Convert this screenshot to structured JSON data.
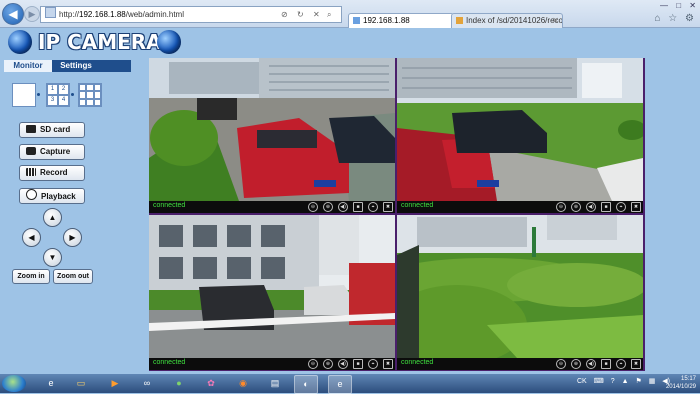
{
  "browser": {
    "address_url_prefix": "http://",
    "address_host": "192.168.1.88",
    "address_path": "/web/admin.html",
    "tabs": [
      {
        "label": "192.168.1.88"
      },
      {
        "label": "Index of /sd/20141026/record0..."
      }
    ],
    "window_controls": [
      "—",
      "□",
      "✕"
    ],
    "tool_icons": [
      "home-icon",
      "star-icon",
      "gear-icon"
    ]
  },
  "banner": {
    "title": "IP CAMERA"
  },
  "panel": {
    "tabs": [
      {
        "label": "Monitor"
      },
      {
        "label": "Settings"
      }
    ],
    "layout4_labels": [
      "1",
      "2",
      "3",
      "4"
    ],
    "buttons": {
      "sd_card": "SD card",
      "capture": "Capture",
      "record": "Record",
      "playback": "Playback",
      "zoom_in": "Zoom in",
      "zoom_out": "Zoom out"
    },
    "arrows": {
      "up": "▲",
      "left": "◀",
      "right": "▶",
      "down": "▼"
    }
  },
  "cameras": [
    {
      "status": "connected"
    },
    {
      "status": "connected"
    },
    {
      "status": "connected"
    },
    {
      "status": "connected"
    }
  ],
  "camera_controls": [
    "⊖",
    "⊕",
    "◀)",
    "■",
    "⌖",
    "✖"
  ],
  "taskbar": {
    "tray_lang": "CK",
    "clock_time": "15:17",
    "clock_date": "2014/10/29"
  },
  "colors": {
    "page_bg": "#9ec3e6",
    "grid_border": "#4a1f6b",
    "status_green": "#3fe03f",
    "tab_dark": "#1f4e8c"
  }
}
